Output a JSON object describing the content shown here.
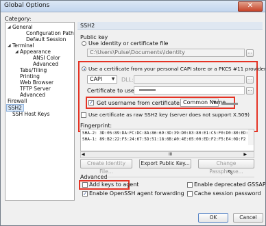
{
  "window": {
    "title": "Global Options",
    "close_glyph": "✕"
  },
  "category_label": "Category:",
  "tree": {
    "items": [
      {
        "label": "General"
      },
      {
        "label": "Configuration Paths"
      },
      {
        "label": "Default Session"
      },
      {
        "label": "Terminal"
      },
      {
        "label": "Appearance"
      },
      {
        "label": "ANSI Color"
      },
      {
        "label": "Advanced"
      },
      {
        "label": "Tabs/Tiling"
      },
      {
        "label": "Printing"
      },
      {
        "label": "Web Browser"
      },
      {
        "label": "TFTP Server"
      },
      {
        "label": "Advanced"
      },
      {
        "label": "Firewall"
      },
      {
        "label": "SSH2"
      },
      {
        "label": "SSH Host Keys"
      }
    ],
    "selected": "SSH2"
  },
  "panel": {
    "header": "SSH2",
    "public_key_label": "Public key",
    "use_identity_label": "Use identity or certificate file",
    "identity_path": "C:\\Users\\Pulse\\Documents\\Identity",
    "ellipsis": "...",
    "use_cert_label": "Use a certificate from your personal CAPI store or a PKCS #11 provider DLL",
    "capi_value": "CAPI",
    "dll_label": "DLL:",
    "cert_to_use_label": "Certificate to use:",
    "get_username_label": "Get username from certificate:",
    "common_name_value": "Common Name",
    "raw_ssh2_label": "Use certificate as raw SSH2 key (server does not support X.509)",
    "fingerprint_label": "Fingerprint:",
    "fingerprint_lines": [
      "SHA-2: 3D:05:89:DA:FC:DC:8A:86:69:3D:39:D0:83:80:E1:C5:F0:D0:80:ED:A",
      "SHA-1: 89:B2:22:F5:24:67:5D:51:18:6B:A0:4E:65:00:ED:F2:F5:E4:0D:F2"
    ],
    "scroll_thumb": "III",
    "create_identity_label": "Create Identity File...",
    "export_public_key_label": "Export Public Key...",
    "change_passphrase_label": "Change Passphrase...",
    "advanced_label": "Advanced",
    "add_keys_label": "Add keys to agent",
    "enable_deprecated_label": "Enable deprecated GSSAPI",
    "enable_openssh_label": "Enable OpenSSH agent forwarding",
    "cache_session_label": "Cache session password"
  },
  "footer": {
    "ok_label": "OK",
    "cancel_label": "Cancel"
  },
  "colors": {
    "highlight": "#e53324",
    "accent": "#1c57b5",
    "header_bg": "#dfe7f1"
  }
}
